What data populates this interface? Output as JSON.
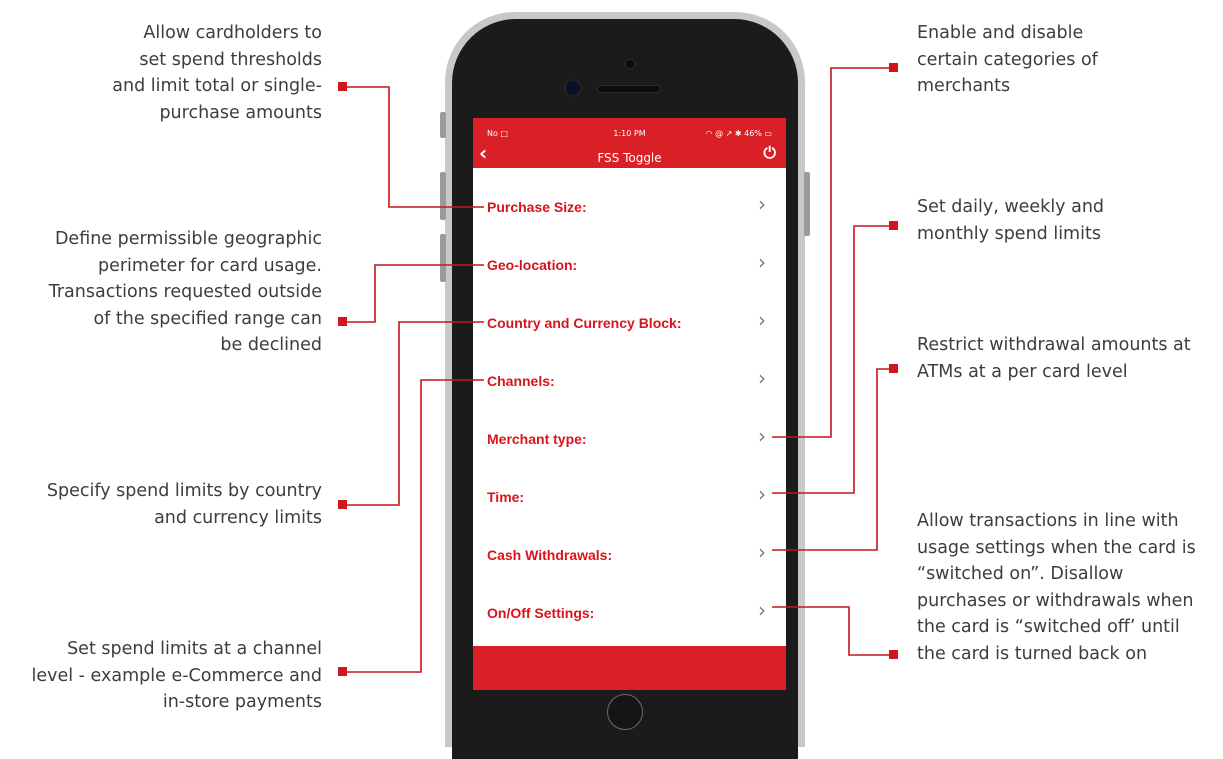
{
  "annotations_left": [
    [
      "Allow cardholders to",
      "set spend thresholds",
      "and limit total or single-",
      "purchase amounts"
    ],
    [
      "Define permissible geographic",
      "perimeter for card usage.",
      "Transactions requested outside",
      "of the specified range can",
      "be declined"
    ],
    [
      "Specify spend limits by country",
      "and currency limits"
    ],
    [
      "Set spend limits at a channel",
      "level - example e-Commerce and",
      "in-store payments"
    ]
  ],
  "annotations_right": [
    [
      "Enable and disable",
      "certain categories of",
      "merchants"
    ],
    [
      "Set daily, weekly and",
      "monthly spend limits"
    ],
    [
      "Restrict withdrawal amounts at",
      "ATMs at a per card level"
    ],
    [
      "Allow transactions in line with",
      "usage settings when the card is",
      "“switched on”. Disallow",
      "purchases or withdrawals when",
      "the card is “switched off’ until",
      "the card is turned back on"
    ]
  ],
  "status_bar": {
    "carrier": "No □",
    "time": "1:10 PM",
    "right": "◠ @ ↗ ✱ 46% ▭"
  },
  "navbar": {
    "back": "‹",
    "title": "FSS Toggle",
    "power": "⏻"
  },
  "menu_items": [
    {
      "label": "Purchase Size:",
      "chevron": "›"
    },
    {
      "label": "Geo-location:",
      "chevron": "›"
    },
    {
      "label": "Country and Currency Block:",
      "chevron": "›"
    },
    {
      "label": "Channels:",
      "chevron": "›"
    },
    {
      "label": "Merchant type:",
      "chevron": "›"
    },
    {
      "label": "Time:",
      "chevron": "›"
    },
    {
      "label": "Cash Withdrawals:",
      "chevron": "›"
    },
    {
      "label": "On/Off Settings:",
      "chevron": "›"
    }
  ],
  "colors": {
    "accent": "#d92027",
    "label_red": "#d7141c",
    "connector": "#c4161c"
  }
}
